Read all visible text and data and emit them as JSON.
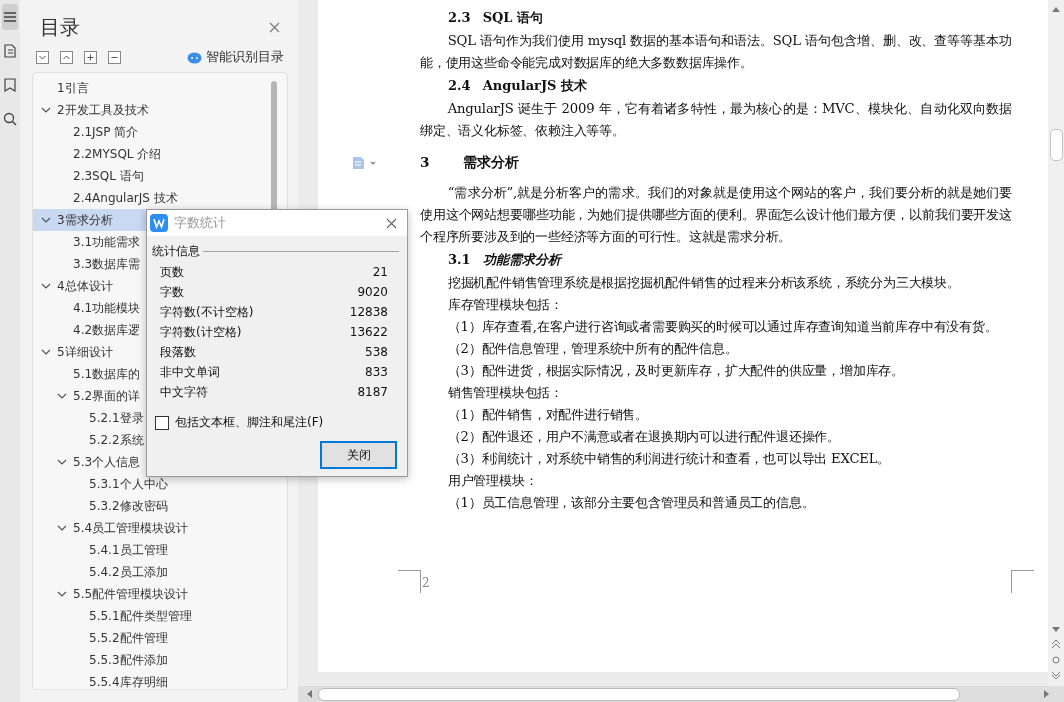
{
  "left_toolbar": {
    "items": [
      {
        "kind": "toc",
        "selected": true
      },
      {
        "kind": "page",
        "selected": false
      },
      {
        "kind": "bookmark",
        "selected": false
      },
      {
        "kind": "find",
        "selected": false
      }
    ]
  },
  "nav_pane": {
    "title": "目录",
    "smart_toc_label": "智能识别目录",
    "toc": [
      {
        "label": "1引言",
        "selected": false
      },
      {
        "label": "2开发工具及技术",
        "selected": false,
        "expanded": true,
        "children": [
          {
            "label": "2.1JSP 简介",
            "selected": false
          },
          {
            "label": "2.2MYSQL 介绍",
            "selected": false
          },
          {
            "label": "2.3SQL 语句",
            "selected": false
          },
          {
            "label": "2.4AngularJS 技术",
            "selected": false
          }
        ]
      },
      {
        "label": "3需求分析",
        "selected": true,
        "expanded": true,
        "children": [
          {
            "label": "3.1功能需求",
            "selected": false
          },
          {
            "label": "3.3数据库需",
            "selected": false
          }
        ]
      },
      {
        "label": "4总体设计",
        "selected": false,
        "expanded": true,
        "children": [
          {
            "label": "4.1功能模块",
            "selected": false
          },
          {
            "label": "4.2数据库逻",
            "selected": false
          }
        ]
      },
      {
        "label": "5详细设计",
        "selected": false,
        "expanded": true,
        "children": [
          {
            "label": "5.1数据库的",
            "selected": false
          },
          {
            "label": "5.2界面的详",
            "selected": false,
            "expanded": true,
            "children": [
              {
                "label": "5.2.1登录",
                "selected": false
              },
              {
                "label": "5.2.2系统",
                "selected": false
              }
            ]
          },
          {
            "label": "5.3个人信息",
            "selected": false,
            "expanded": true,
            "children": [
              {
                "label": "5.3.1个人中心",
                "selected": false
              },
              {
                "label": "5.3.2修改密码",
                "selected": false
              }
            ]
          },
          {
            "label": "5.4员工管理模块设计",
            "selected": false,
            "expanded": true,
            "children": [
              {
                "label": "5.4.1员工管理",
                "selected": false
              },
              {
                "label": "5.4.2员工添加",
                "selected": false
              }
            ]
          },
          {
            "label": "5.5配件管理模块设计",
            "selected": false,
            "expanded": true,
            "children": [
              {
                "label": "5.5.1配件类型管理",
                "selected": false
              },
              {
                "label": "5.5.2配件管理",
                "selected": false
              },
              {
                "label": "5.5.3配件添加",
                "selected": false
              },
              {
                "label": "5.5.4库存明细",
                "selected": false
              }
            ]
          }
        ]
      }
    ]
  },
  "word_count_dialog": {
    "title": "字数统计",
    "group_label": "统计信息",
    "stats": [
      {
        "label": "页数",
        "value": "21"
      },
      {
        "label": "字数",
        "value": "9020"
      },
      {
        "label": "字符数(不计空格)",
        "value": "12838"
      },
      {
        "label": "字符数(计空格)",
        "value": "13622"
      },
      {
        "label": "段落数",
        "value": "538"
      },
      {
        "label": "非中文单词",
        "value": "833"
      },
      {
        "label": "中文字符",
        "value": "8187"
      }
    ],
    "checkbox": {
      "label": "包括文本框、脚注和尾注(F)",
      "checked": false
    },
    "close_button": "关闭"
  },
  "document": {
    "blocks": [
      {
        "kind": "subheading",
        "number": "2.3",
        "text": "SQL 语句"
      },
      {
        "kind": "paragraph",
        "text": "SQL 语句作为我们使用 mysql 数据的基本语句和语法。SQL 语句包含增、删、改、查等等基本功能，使用这些命令能完成对数据库的绝大多数数据库操作。"
      },
      {
        "kind": "subheading",
        "number": "2.4",
        "text": "AngularJS 技术"
      },
      {
        "kind": "paragraph",
        "text": "AngularJS 诞生于 2009 年，它有着诸多特性，最为核心的是：MVC、模块化、自动化双向数据绑定、语义化标签、依赖注入等等。"
      },
      {
        "kind": "heading",
        "number": "3",
        "text": "需求分析"
      },
      {
        "kind": "paragraph",
        "text": "“需求分析”,就是分析客户的需求。我们的对象就是使用这个网站的客户，我们要分析的就是她们要使用这个网站想要哪些功能，为她们提供哪些方面的便利。界面怎么设计他们最方便，以前我们要开发这个程序所要涉及到的一些经济等方面的可行性。这就是需求分析。"
      },
      {
        "kind": "subheading-italic",
        "number": "3.1",
        "text": "功能需求分析"
      },
      {
        "kind": "paragraph",
        "text": "挖掘机配件销售管理系统是根据挖掘机配件销售的过程来分析该系统，系统分为三大模块。"
      },
      {
        "kind": "paragraph",
        "text": "库存管理模块包括："
      },
      {
        "kind": "paragraph",
        "text": "（1）库存查看,在客户进行咨询或者需要购买的时候可以通过库存查询知道当前库存中有没有货。"
      },
      {
        "kind": "paragraph",
        "text": "（2）配件信息管理，管理系统中所有的配件信息。"
      },
      {
        "kind": "paragraph",
        "text": "（3）配件进货，根据实际情况，及时更新库存，扩大配件的供应量，增加库存。"
      },
      {
        "kind": "paragraph",
        "text": "销售管理模块包括："
      },
      {
        "kind": "paragraph",
        "text": "（1）配件销售，对配件进行销售。"
      },
      {
        "kind": "paragraph",
        "text": "（2）配件退还，用户不满意或者在退换期内可以进行配件退还操作。"
      },
      {
        "kind": "paragraph",
        "text": "（3）利润统计，对系统中销售的利润进行统计和查看，也可以导出 EXCEL。"
      },
      {
        "kind": "paragraph",
        "text": "用户管理模块："
      },
      {
        "kind": "paragraph",
        "text": "（1）员工信息管理，该部分主要包含管理员和普通员工的信息。"
      }
    ],
    "page_number": "2"
  }
}
